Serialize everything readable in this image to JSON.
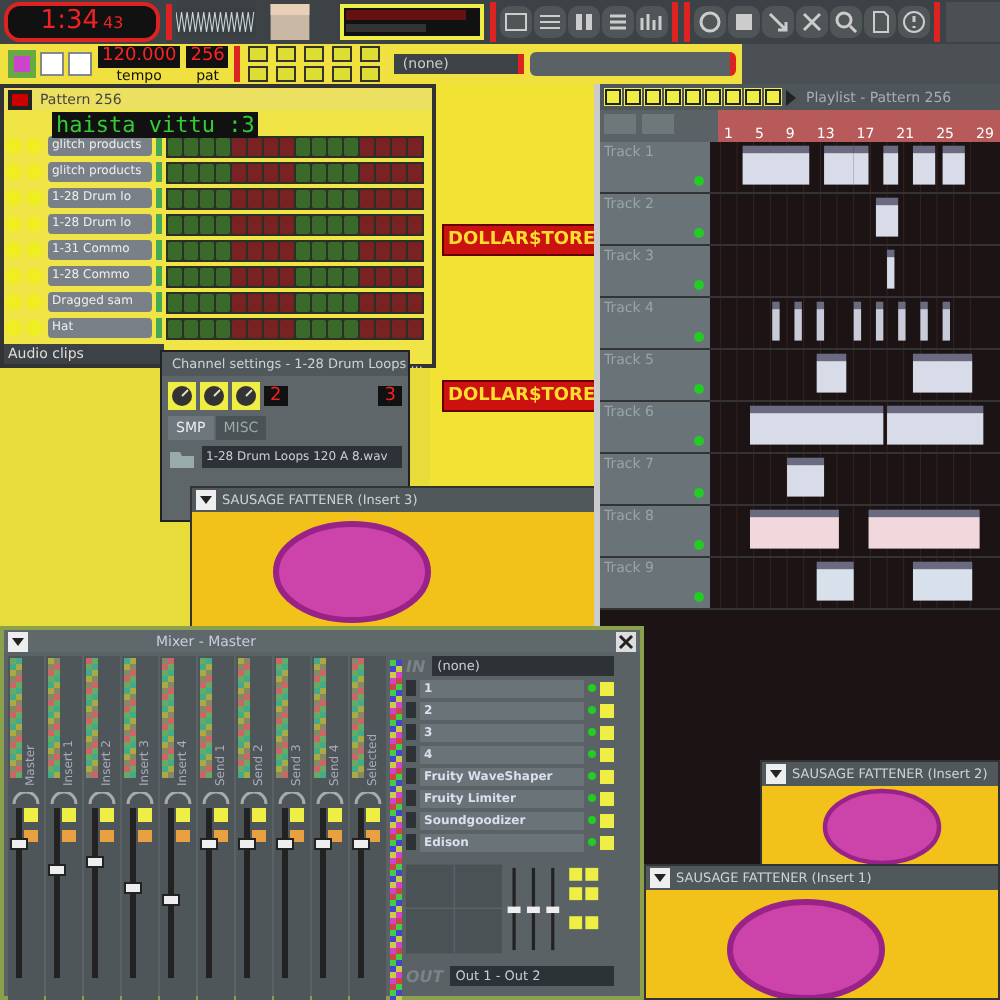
{
  "transport": {
    "time_main": "1:34",
    "time_sub": "43",
    "tempo": "120.000",
    "tempo_label": "tempo",
    "pattern": "256",
    "pattern_label": "pat",
    "pattern_select": "(none)"
  },
  "step_sequencer": {
    "title": "Pattern 256",
    "overlay_text": "haista vittu :3",
    "channels": [
      {
        "name": "glitch products"
      },
      {
        "name": "glitch products"
      },
      {
        "name": "1-28 Drum lo"
      },
      {
        "name": "1-28 Drum lo"
      },
      {
        "name": "1-31 Commo"
      },
      {
        "name": "1-28 Commo"
      },
      {
        "name": "Dragged sam"
      },
      {
        "name": "Hat"
      }
    ],
    "footer": "Audio clips"
  },
  "logos": [
    {
      "text": "DOLLAR$TORE"
    },
    {
      "text": "DOLLAR$TORE"
    }
  ],
  "channel_settings": {
    "title": "Channel settings - 1-28 Drum Loops ...",
    "value_a": "2",
    "value_b": "3",
    "tabs": [
      {
        "label": "SMP",
        "selected": true
      },
      {
        "label": "MISC",
        "selected": false
      }
    ],
    "file": "1-28 Drum Loops 120 A 8.wav"
  },
  "plugin_windows": [
    {
      "title": "SAUSAGE FATTENER (Insert 3)"
    },
    {
      "title": "SAUSAGE FATTENER (Insert 2)"
    },
    {
      "title": "SAUSAGE FATTENER (Insert 1)"
    }
  ],
  "playlist": {
    "title": "Playlist - Pattern 256",
    "ruler": [
      "1",
      "5",
      "9",
      "13",
      "17",
      "21",
      "25",
      "29"
    ],
    "tracks": [
      "Track 1",
      "Track 2",
      "Track 3",
      "Track 4",
      "Track 5",
      "Track 6",
      "Track 7",
      "Track 8",
      "Track 9"
    ]
  },
  "mixer": {
    "title": "Mixer - Master",
    "strips": [
      {
        "name": "Master",
        "level": 0.75
      },
      {
        "name": "Insert 1",
        "level": 0.6
      },
      {
        "name": "Insert 2",
        "level": 0.65
      },
      {
        "name": "Insert 3",
        "level": 0.5
      },
      {
        "name": "Insert 4",
        "level": 0.42
      },
      {
        "name": "Send 1",
        "level": 0.75
      },
      {
        "name": "Send 2",
        "level": 0.75
      },
      {
        "name": "Send 3",
        "level": 0.75
      },
      {
        "name": "Send 4",
        "level": 0.75
      },
      {
        "name": "Selected",
        "level": 0.75
      }
    ],
    "in_label": "IN",
    "in_value": "(none)",
    "slots": [
      {
        "name": "1"
      },
      {
        "name": "2"
      },
      {
        "name": "3"
      },
      {
        "name": "4"
      },
      {
        "name": "Fruity WaveShaper"
      },
      {
        "name": "Fruity Limiter"
      },
      {
        "name": "Soundgoodizer"
      },
      {
        "name": "Edison"
      }
    ],
    "out_label": "OUT",
    "out_value": "Out 1 - Out 2"
  }
}
